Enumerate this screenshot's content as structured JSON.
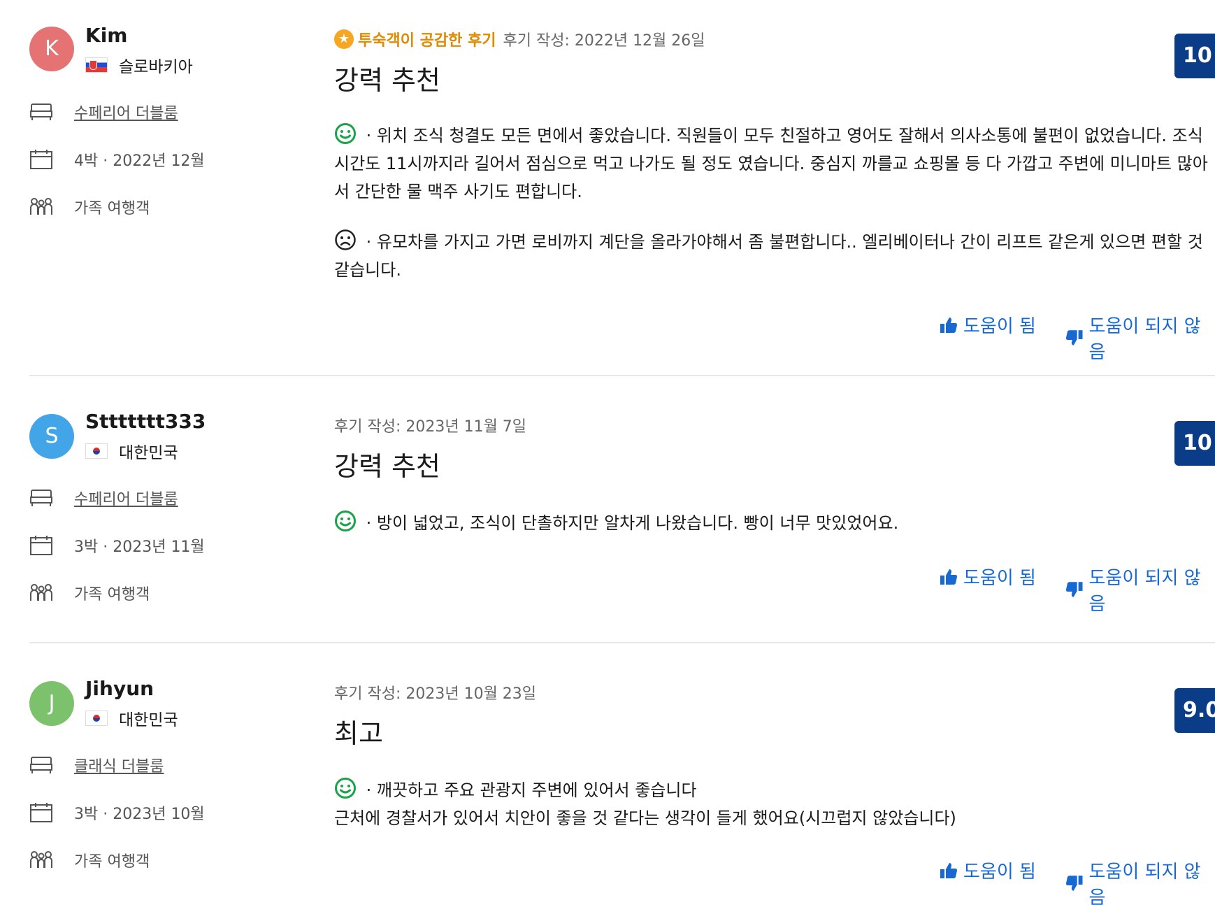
{
  "reviews": [
    {
      "initial": "K",
      "avatar_color": "#e57373",
      "name": "Kim",
      "country": "슬로바키아",
      "flag": "slovakia",
      "room": "수페리어 더블룸",
      "stay": "4박 ·  2022년 12월",
      "traveler": "가족 여행객",
      "recommended_badge": "투숙객이 공감한 후기",
      "date": "후기 작성: 2022년 12월 26일",
      "title": "강력 추천",
      "positive": " · 위치 조식 청결도 모든 면에서 좋았습니다. 직원들이 모두 친절하고 영어도 잘해서 의사소통에 불편이 없었습니다. 조식 시간도 11시까지라 길어서 점심으로 먹고 나가도 될 정도 였습니다. 중심지 까를교 쇼핑몰 등 다 가깝고 주변에 미니마트 많아서 간단한 물 맥주 사기도 편합니다.",
      "negative": " · 유모차를 가지고 가면 로비까지 계단을 올라가야해서 좀 불편합니다.. 엘리베이터나 간이 리프트 같은게 있으면 편할 것 같습니다.",
      "score": "10",
      "helpful": "도움이 됨",
      "not_helpful": "도움이 되지 않음"
    },
    {
      "initial": "S",
      "avatar_color": "#42a5e8",
      "name": "Sttttttt333",
      "country": "대한민국",
      "flag": "korea",
      "room": "수페리어 더블룸",
      "stay": "3박 ·  2023년 11월",
      "traveler": "가족 여행객",
      "date": "후기 작성: 2023년 11월 7일",
      "title": "강력 추천",
      "positive": " · 방이 넓었고, 조식이 단촐하지만 알차게 나왔습니다. 빵이 너무 맛있었어요.",
      "score": "10",
      "helpful": "도움이 됨",
      "not_helpful": "도움이 되지 않음"
    },
    {
      "initial": "J",
      "avatar_color": "#7cc16b",
      "name": "Jihyun",
      "country": "대한민국",
      "flag": "korea",
      "room": "클래식 더블룸",
      "stay": "3박 ·  2023년 10월",
      "traveler": "가족 여행객",
      "date": "후기 작성: 2023년 10월 23일",
      "title": "최고",
      "positive": " · 깨끗하고 주요 관광지 주변에 있어서 좋습니다",
      "positive_line2": "근처에 경찰서가 있어서 치안이 좋을 것 같다는 생각이 들게 했어요(시끄럽지 않았습니다)",
      "score": "9.0",
      "helpful": "도움이 됨",
      "not_helpful": "도움이 되지 않음"
    }
  ]
}
